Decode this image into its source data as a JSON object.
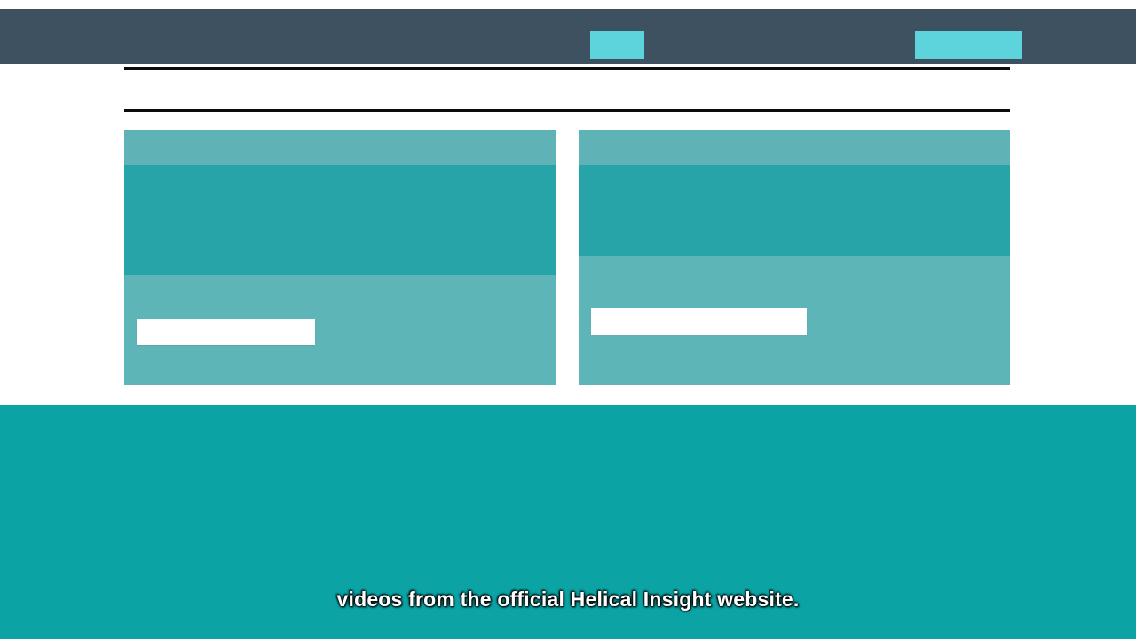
{
  "colors": {
    "navbar": "#3e5160",
    "nav_button": "#5dd3dc",
    "card_header": "#5fb3b6",
    "card_band": "#27a4a8",
    "card_body": "#5eb5b7",
    "card_button": "#ffffff",
    "footer": "#0ba3a4",
    "rule": "#0c0c0c"
  },
  "subtitle": {
    "text": "videos from the official Helical Insight website."
  }
}
